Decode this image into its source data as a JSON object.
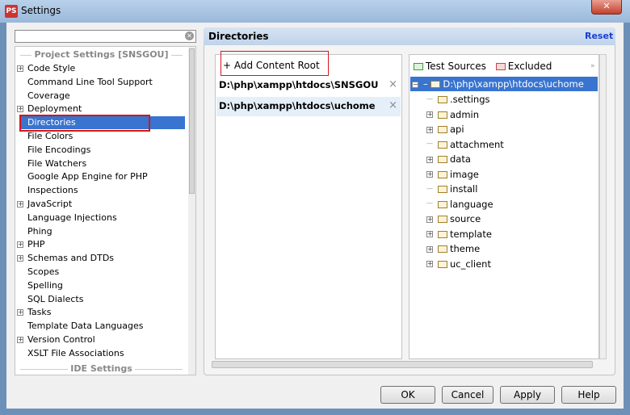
{
  "window": {
    "title": "Settings",
    "close": "✕"
  },
  "search": {
    "value": "",
    "placeholder": ""
  },
  "sidebar": {
    "section_project": "Project Settings [SNSGOU]",
    "section_ide": "IDE Settings",
    "items": [
      {
        "label": "Code Style",
        "expandable": true
      },
      {
        "label": "Command Line Tool Support",
        "expandable": false
      },
      {
        "label": "Coverage",
        "expandable": false
      },
      {
        "label": "Deployment",
        "expandable": true
      },
      {
        "label": "Directories",
        "expandable": false,
        "selected": true
      },
      {
        "label": "File Colors",
        "expandable": false
      },
      {
        "label": "File Encodings",
        "expandable": false
      },
      {
        "label": "File Watchers",
        "expandable": false
      },
      {
        "label": "Google App Engine for PHP",
        "expandable": false
      },
      {
        "label": "Inspections",
        "expandable": false
      },
      {
        "label": "JavaScript",
        "expandable": true
      },
      {
        "label": "Language Injections",
        "expandable": false
      },
      {
        "label": "Phing",
        "expandable": false
      },
      {
        "label": "PHP",
        "expandable": true
      },
      {
        "label": "Schemas and DTDs",
        "expandable": true
      },
      {
        "label": "Scopes",
        "expandable": false
      },
      {
        "label": "Spelling",
        "expandable": false
      },
      {
        "label": "SQL Dialects",
        "expandable": false
      },
      {
        "label": "Tasks",
        "expandable": true
      },
      {
        "label": "Template Data Languages",
        "expandable": false
      },
      {
        "label": "Version Control",
        "expandable": true
      },
      {
        "label": "XSLT File Associations",
        "expandable": false
      }
    ]
  },
  "main": {
    "title": "Directories",
    "reset": "Reset",
    "add_content_root": "+ Add Content Root",
    "content_roots": [
      "D:\\php\\xampp\\htdocs\\SNSGOU",
      "D:\\php\\xampp\\htdocs\\uchome"
    ],
    "remove_icon": "×",
    "toolbar": {
      "test_sources": "Test Sources",
      "excluded": "Excluded",
      "more": "»"
    },
    "tree": {
      "root": "D:\\php\\xampp\\htdocs\\uchome",
      "children": [
        {
          "label": ".settings",
          "expandable": false
        },
        {
          "label": "admin",
          "expandable": true
        },
        {
          "label": "api",
          "expandable": true
        },
        {
          "label": "attachment",
          "expandable": false
        },
        {
          "label": "data",
          "expandable": true
        },
        {
          "label": "image",
          "expandable": true
        },
        {
          "label": "install",
          "expandable": false
        },
        {
          "label": "language",
          "expandable": false
        },
        {
          "label": "source",
          "expandable": true
        },
        {
          "label": "template",
          "expandable": true
        },
        {
          "label": "theme",
          "expandable": true
        },
        {
          "label": "uc_client",
          "expandable": true
        }
      ]
    }
  },
  "buttons": {
    "ok": "OK",
    "cancel": "Cancel",
    "apply": "Apply",
    "help": "Help"
  },
  "colors": {
    "selection": "#3874d0",
    "highlight_box": "#d4161b",
    "link": "#1a3fcf"
  }
}
